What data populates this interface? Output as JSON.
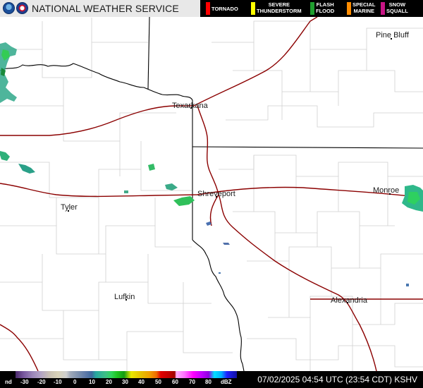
{
  "header": {
    "title": "NATIONAL WEATHER SERVICE",
    "logos": [
      "noaa-logo",
      "nws-logo"
    ]
  },
  "warning_legend": [
    {
      "label_lines": [
        "TORNADO"
      ],
      "color": "#ff0000"
    },
    {
      "label_lines": [
        "SEVERE",
        "THUNDERSTORM"
      ],
      "color": "#ffff00"
    },
    {
      "label_lines": [
        "FLASH",
        "FLOOD"
      ],
      "color": "#1f9f2f"
    },
    {
      "label_lines": [
        "SPECIAL",
        "MARINE"
      ],
      "color": "#ff8c00"
    },
    {
      "label_lines": [
        "SNOW",
        "SQUALL"
      ],
      "color": "#c71585"
    }
  ],
  "cities": [
    {
      "name": "Pine Bluff"
    },
    {
      "name": "Texarkana"
    },
    {
      "name": "Shreveport"
    },
    {
      "name": "Monroe"
    },
    {
      "name": "Tyler"
    },
    {
      "name": "Lufkin"
    },
    {
      "name": "Alexandria"
    }
  ],
  "colors": {
    "county_lines": "#d0d0d0",
    "state_lines": "#000000",
    "highways": "#8b0000"
  },
  "reflectivity_scale": {
    "ticks": [
      "nd",
      "-30",
      "-20",
      "-10",
      "0",
      "10",
      "20",
      "30",
      "40",
      "50",
      "60",
      "70",
      "80",
      "dBZ"
    ]
  },
  "timestamp": "07/02/2025 04:54 UTC (23:54 CDT) KSHV"
}
